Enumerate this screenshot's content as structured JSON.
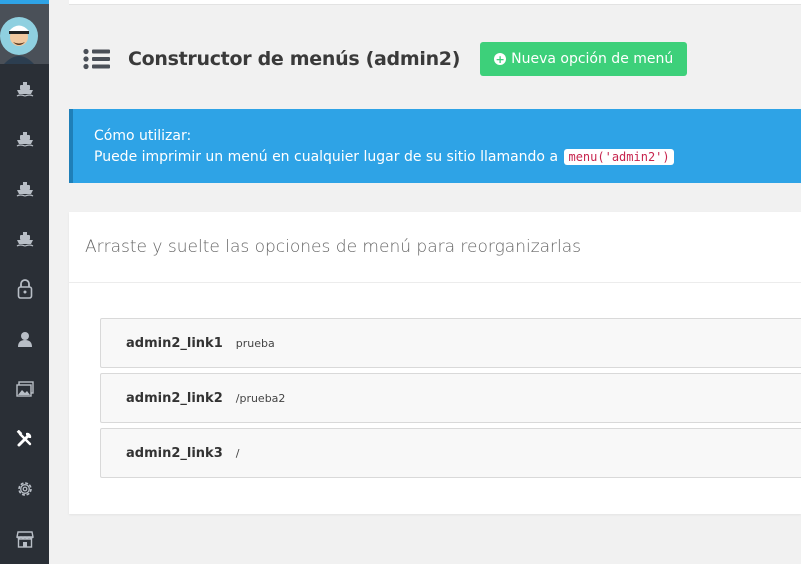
{
  "sidebar": {
    "items": [
      {
        "icon": "ship-icon"
      },
      {
        "icon": "ship-icon"
      },
      {
        "icon": "ship-icon"
      },
      {
        "icon": "ship-icon"
      },
      {
        "icon": "lock-icon"
      },
      {
        "icon": "user-icon"
      },
      {
        "icon": "images-icon"
      },
      {
        "icon": "tools-icon"
      },
      {
        "icon": "gear-icon"
      },
      {
        "icon": "store-icon"
      }
    ]
  },
  "header": {
    "title": "Constructor de menús (admin2)",
    "new_button_label": "Nueva opción de menú"
  },
  "alert": {
    "heading": "Cómo utilizar:",
    "text": "Puede imprimir un menú en cualquier lugar de su sitio llamando a",
    "code": "menu('admin2')"
  },
  "card": {
    "heading": "Arraste y suelte las opciones de menú para reorganizarlas"
  },
  "menu_items": [
    {
      "name": "admin2_link1",
      "url": "prueba"
    },
    {
      "name": "admin2_link2",
      "url": "/prueba2"
    },
    {
      "name": "admin2_link3",
      "url": "/"
    }
  ],
  "colors": {
    "sidebar_bg": "#2a2f36",
    "accent_blue": "#2ea3e6",
    "success_green": "#3dd07a"
  }
}
